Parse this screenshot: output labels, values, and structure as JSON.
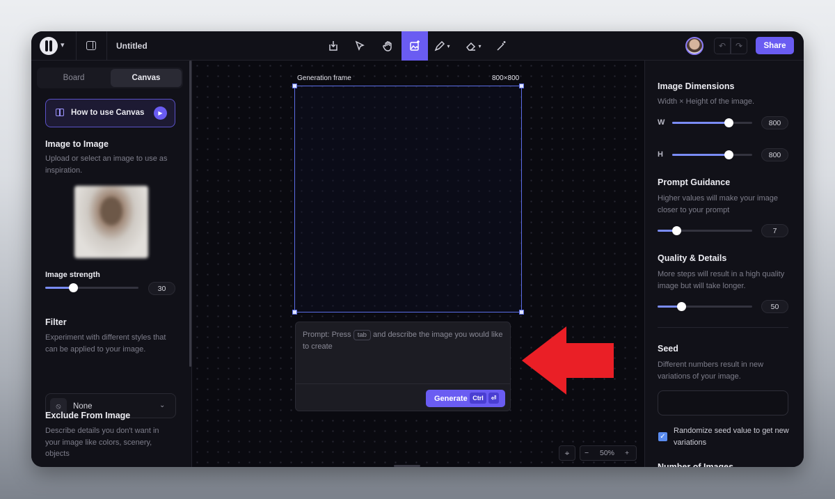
{
  "header": {
    "title": "Untitled",
    "share_label": "Share",
    "undo_icon": "↶",
    "redo_icon": "↷",
    "tools": [
      "import-icon",
      "select-pointer-icon",
      "hand-pan-icon",
      "generate-image-icon",
      "pencil-draw-icon",
      "eraser-icon",
      "magic-wand-icon"
    ],
    "active_tool": "generate-image-icon",
    "accent_color": "#6a5cf2"
  },
  "left": {
    "tabs": {
      "board": "Board",
      "canvas": "Canvas",
      "active": "Canvas"
    },
    "how_to": "How to use Canvas",
    "img2img": {
      "title": "Image to Image",
      "desc": "Upload or select an image to use as inspiration."
    },
    "strength": {
      "label": "Image strength",
      "value": "30",
      "fraction": 0.3
    },
    "filter": {
      "title": "Filter",
      "desc": "Experiment with different styles that can be applied to your image.",
      "selected": "None"
    },
    "exclude": {
      "title": "Exclude From Image",
      "desc": "Describe details you don't want in your image like colors, scenery, objects"
    }
  },
  "canvas": {
    "frame_label": "Generation frame",
    "frame_size": "800×800",
    "prompt": {
      "pre": "Prompt: Press",
      "key": "tab",
      "post": "and describe the image you would like to create"
    },
    "generate": {
      "label": "Generate",
      "key1": "Ctrl",
      "key2": "⏎"
    },
    "zoom": {
      "value": "50%",
      "minus": "−",
      "plus": "+"
    }
  },
  "right": {
    "dimensions": {
      "title": "Image Dimensions",
      "desc": "Width × Height of the image.",
      "w_label": "W",
      "w_value": "800",
      "w_fraction": 0.7,
      "h_label": "H",
      "h_value": "800",
      "h_fraction": 0.7
    },
    "guidance": {
      "title": "Prompt Guidance",
      "desc": "Higher values will make your image closer to your prompt",
      "value": "7",
      "fraction": 0.2
    },
    "quality": {
      "title": "Quality & Details",
      "desc": "More steps will result in a high quality image but will take longer.",
      "value": "50",
      "fraction": 0.25
    },
    "seed": {
      "title": "Seed",
      "desc": "Different numbers result in new variations of your image.",
      "input_value": "",
      "randomize_label": "Randomize seed value to get new variations",
      "randomize_checked": true
    },
    "cut_heading": "Number of Images"
  }
}
